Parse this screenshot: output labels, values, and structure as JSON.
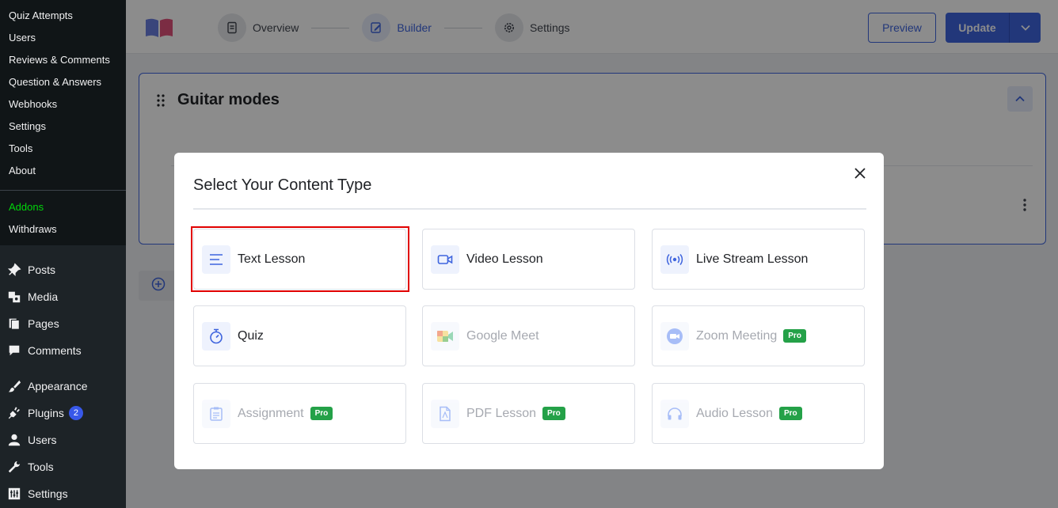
{
  "sidebar": {
    "subitems_top": [
      "Quiz Attempts",
      "Users",
      "Reviews & Comments",
      "Question & Answers",
      "Webhooks",
      "Settings",
      "Tools",
      "About"
    ],
    "subitems_bottom": [
      "Addons",
      "Withdraws"
    ],
    "menu": [
      {
        "label": "Posts",
        "icon": "pushpin-icon"
      },
      {
        "label": "Media",
        "icon": "media-icon"
      },
      {
        "label": "Pages",
        "icon": "pages-icon"
      },
      {
        "label": "Comments",
        "icon": "comment-icon"
      },
      {
        "label": "Appearance",
        "icon": "paintbrush-icon"
      },
      {
        "label": "Plugins",
        "icon": "plugin-icon",
        "badge": "2"
      },
      {
        "label": "Users",
        "icon": "user-icon"
      },
      {
        "label": "Tools",
        "icon": "wrench-icon"
      },
      {
        "label": "Settings",
        "icon": "settings-icon"
      }
    ]
  },
  "header": {
    "steps": [
      "Overview",
      "Builder",
      "Settings"
    ],
    "active_step": "Builder",
    "preview_label": "Preview",
    "update_label": "Update"
  },
  "topic": {
    "title": "Guitar modes"
  },
  "modal": {
    "title": "Select Your Content Type",
    "tiles": [
      {
        "label": "Text Lesson",
        "icon": "text-lines-icon",
        "pro": false,
        "enabled": true,
        "selected": true
      },
      {
        "label": "Video Lesson",
        "icon": "video-camera-icon",
        "pro": false,
        "enabled": true
      },
      {
        "label": "Live Stream Lesson",
        "icon": "broadcast-icon",
        "pro": false,
        "enabled": true
      },
      {
        "label": "Quiz",
        "icon": "stopwatch-icon",
        "pro": false,
        "enabled": true
      },
      {
        "label": "Google Meet",
        "icon": "google-meet-icon",
        "pro": false,
        "enabled": false
      },
      {
        "label": "Zoom Meeting",
        "icon": "zoom-icon",
        "pro": true,
        "enabled": false
      },
      {
        "label": "Assignment",
        "icon": "clipboard-icon",
        "pro": true,
        "enabled": false
      },
      {
        "label": "PDF Lesson",
        "icon": "pdf-file-icon",
        "pro": true,
        "enabled": false
      },
      {
        "label": "Audio Lesson",
        "icon": "headphones-icon",
        "pro": true,
        "enabled": false
      }
    ],
    "pro_label": "Pro"
  },
  "colors": {
    "accent": "#3e64de",
    "sidebar_bg": "#1d2327",
    "addons_green": "#00d60a",
    "pro_badge": "#24a148",
    "highlight_red": "#e10000"
  }
}
